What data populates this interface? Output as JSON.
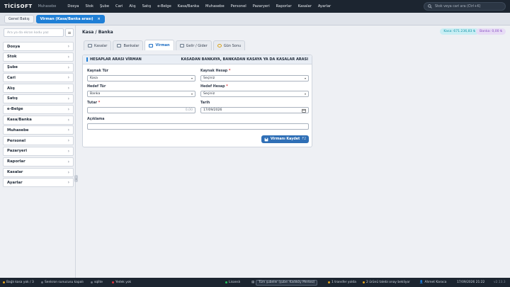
{
  "app": {
    "logo": "TİCİSOFT",
    "module": "Muhasebe"
  },
  "top_menu": [
    "Dosya",
    "Stok",
    "Şube",
    "Cari",
    "Alış",
    "Satış",
    "e-Belge",
    "Kasa/Banka",
    "Muhasebe",
    "Personel",
    "Pazaryeri",
    "Raporlar",
    "Kasalar",
    "Ayarlar"
  ],
  "search": {
    "placeholder": "Stok veya cari ara (Ctrl+K)"
  },
  "tabs": {
    "overview": "Genel Bakış",
    "active": "Virman (Kasa/Banka arası)",
    "close": "×"
  },
  "sidebar": {
    "search_placeholder": "Ara ya da ekran kodu yaz",
    "toggle": "≡",
    "items": [
      "Dosya",
      "Stok",
      "Şube",
      "Cari",
      "Alış",
      "Satış",
      "e-Belge",
      "Kasa/Banka",
      "Muhasebe",
      "Personel",
      "Pazaryeri",
      "Raporlar",
      "Kasalar",
      "Ayarlar"
    ],
    "chevron": "›",
    "collapse": "‹"
  },
  "page": {
    "title": "Kasa / Banka",
    "badge_kasa": "Kasa: 671.236,83 ₺",
    "badge_banka": "Banka: 0,00 ₺"
  },
  "subtabs": [
    "Kasalar",
    "Bankalar",
    "Virman",
    "Gelir / Gider",
    "Gün Sonu"
  ],
  "form": {
    "header_left": "HESAPLAR ARASI VİRMAN",
    "header_right": "KASADAN BANKAYA, BANKADAN KASAYA YA DA KASALAR ARASI",
    "kaynak_tur_label": "Kaynak Tür",
    "kaynak_tur_value": "Kasa",
    "kaynak_hesap_label": "Kaynak Hesap",
    "kaynak_hesap_value": "Seçiniz",
    "hedef_tur_label": "Hedef Tür",
    "hedef_tur_value": "Banka",
    "hedef_hesap_label": "Hedef Hesap",
    "hedef_hesap_value": "Seçiniz",
    "tutar_label": "Tutar",
    "tutar_placeholder": "0,00",
    "tarih_label": "Tarih",
    "tarih_value": "17/09/2026",
    "aciklama_label": "Açıklama",
    "aciklama_value": "",
    "required_mark": "*",
    "save_label": "Virmanı Kaydet",
    "save_shortcut": "F2"
  },
  "status": {
    "kasa": "Bağlı kasa yok / 3",
    "sync": "Senkron sunucusu kapalı",
    "db": "sqlite",
    "backup": "Yedek yok",
    "license": "Lisanslı",
    "branch": "Tüm şubeler (şube: Kadıköy Merkez)",
    "transfer": "1 transfer yolda",
    "requests": "2 ürünü talebi onay bekliyor",
    "user": "Ahmet Karaca",
    "datetime": "17/09/2026 21:22",
    "version": "v2.13.3"
  },
  "colors": {
    "accent": "#1f7fd6",
    "topbar": "#1c2530",
    "save": "#2f6fb6",
    "kasa_badge": "#1294a8",
    "banka_badge": "#8a4fc4"
  }
}
